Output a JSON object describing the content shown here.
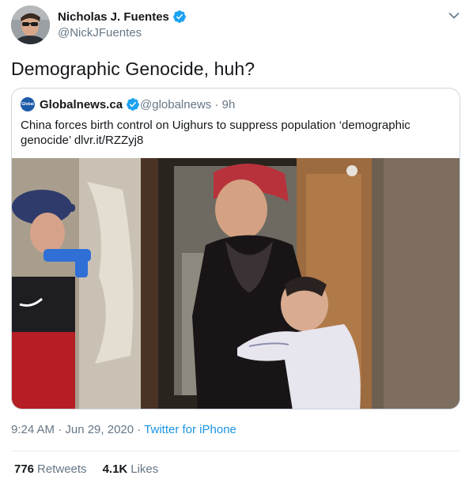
{
  "author": {
    "name": "Nicholas J. Fuentes",
    "handle": "@NickJFuentes",
    "verified": true
  },
  "tweet_text": "Demographic Genocide, huh?",
  "quoted": {
    "logo_text": "Global",
    "name": "Globalnews.ca",
    "meta": "@globalnews · 9h",
    "text": "China forces birth control on Uighurs to suppress population ‘demographic genocide’ dlvr.it/RZZyj8",
    "verified": true
  },
  "footer": {
    "time": "9:24 AM · Jun 29, 2020 · ",
    "source": "Twitter for iPhone"
  },
  "stats": {
    "retweets_count": "776",
    "retweets_label": "Retweets",
    "likes_count": "4.1K",
    "likes_label": "Likes"
  },
  "colors": {
    "accent": "#1da1f2",
    "link": "#1b95e0",
    "muted": "#657786"
  },
  "icons": [
    "verified-badge-icon",
    "chevron-down-icon"
  ]
}
